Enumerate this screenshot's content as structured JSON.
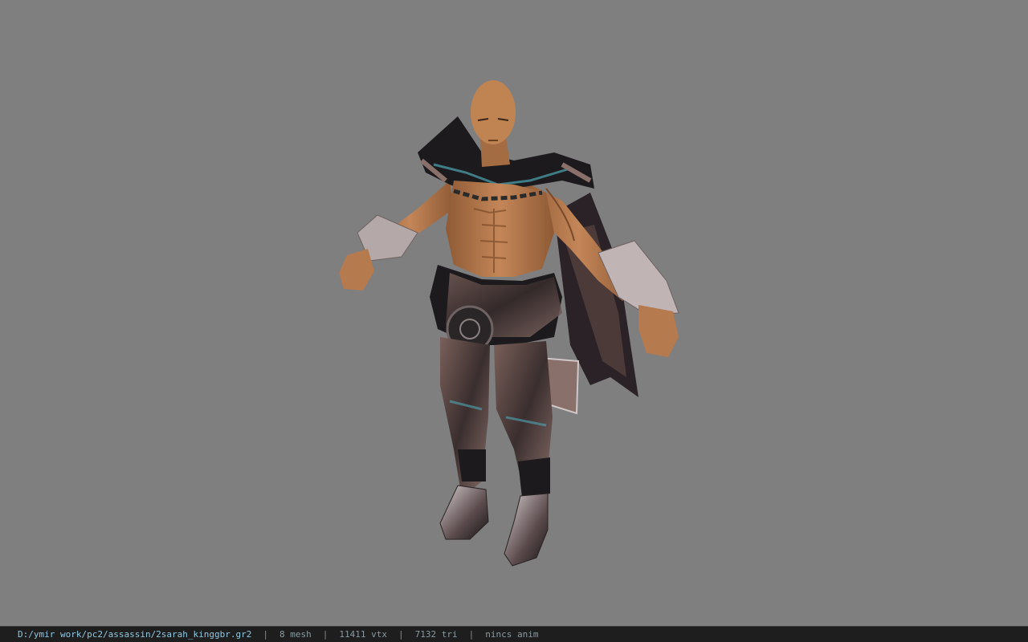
{
  "viewer": {
    "background_color": "#7f7f7f",
    "model_name": "assassin character model"
  },
  "status_bar": {
    "file_path": "D:/ymir work/pc2/assassin/2sarah_kinggbr.gr2",
    "separator": "|",
    "mesh_count": "8 mesh",
    "vertex_count": "11411 vtx",
    "triangle_count": "7132 tri",
    "anim_status": "nincs anim"
  },
  "colors": {
    "skin": "#b57a4e",
    "cloth_dark": "#1c1a1c",
    "cloth_brown": "#6e5650",
    "metal": "#c8c0c0",
    "accent_teal": "#4fa6b4"
  }
}
